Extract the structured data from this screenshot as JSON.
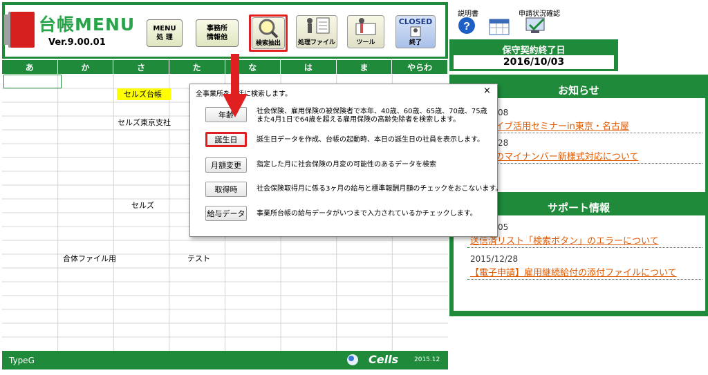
{
  "app": {
    "logo_title": "台帳MENU",
    "version": "Ver.9.00.01"
  },
  "toolbar": {
    "menu_label_1": "MENU",
    "menu_label_2": "処 理",
    "office_label_1": "事務所",
    "office_label_2": "情報他",
    "search_label": "検索抽出",
    "process_file_label": "処理ファイル",
    "tool_label": "ツール",
    "closed_label": "CLOSED",
    "exit_label": "終了"
  },
  "kana_tabs": [
    "あ",
    "か",
    "さ",
    "た",
    "な",
    "は",
    "ま",
    "やらわ"
  ],
  "grid_cells": {
    "sels_daicho": "セルズ台帳",
    "sels_tokyo": "セルズ東京支社",
    "sels": "セルズ",
    "combined_file": "合体ファイル用",
    "test": "テスト"
  },
  "footer": {
    "type": "TypeG",
    "brand": "Cells",
    "year": "2015.12"
  },
  "right": {
    "manual_label": "説明書",
    "status_label": "申請状況確認",
    "contract_end_title": "保守契約終了日",
    "contract_end_date": "2016/10/03",
    "news_title": "お知らせ",
    "news": [
      {
        "date": "/08",
        "title": "イブ活用セミナーin東京・名古屋"
      },
      {
        "date": "/28",
        "title": "のマイナンバー新様式対応について"
      }
    ],
    "support_title": "サポート情報",
    "support": [
      {
        "date": "/05",
        "title": "送信済リスト「検索ボタン」のエラーについて"
      },
      {
        "date": "2015/12/28",
        "title": "【電子申請】雇用継続給付の添付ファイルについて"
      }
    ]
  },
  "dialog": {
    "title": "全事業所を一括に検索します。",
    "close": "×",
    "items": [
      {
        "label": "年齢",
        "desc1": "社会保険、雇用保険の被保険者で本年、40歳、60歳、65歳、70歳、75歳",
        "desc2": "また4月1日で64歳を超える雇用保険の高齢免除者を検索します。"
      },
      {
        "label": "誕生日",
        "desc1": "誕生日データを作成、台帳の起動時、本日の誕生日の社員を表示します。",
        "desc2": ""
      },
      {
        "label": "月額変更",
        "desc1": "指定した月に社会保険の月変の可能性のあるデータを検索",
        "desc2": ""
      },
      {
        "label": "取得時",
        "desc1": "社会保険取得月に係る3ヶ月の給与と標準報酬月額のチェックをおこないます。",
        "desc2": ""
      },
      {
        "label": "給与データ",
        "desc1": "事業所台帳の給与データがいつまで入力されているかチェックします。",
        "desc2": ""
      }
    ]
  },
  "colors": {
    "green": "#1e8a3a",
    "highlight": "#ffff00",
    "accent_red": "#e02020",
    "link_orange": "#e05a00"
  }
}
